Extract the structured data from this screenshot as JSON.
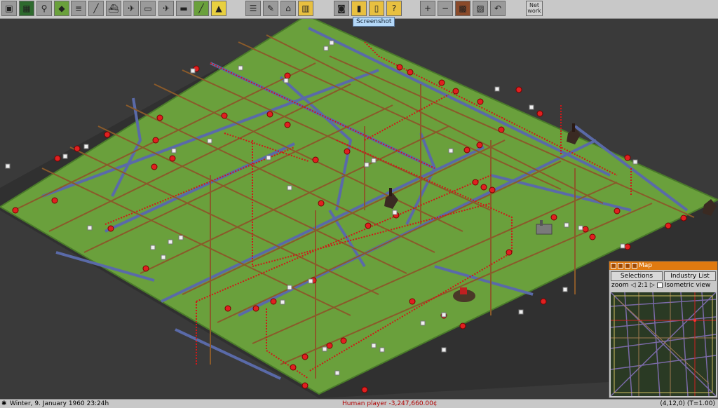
{
  "toolbar": {
    "icons": [
      "save-icon",
      "minimap-icon",
      "search-icon",
      "terrain-icon",
      "railway-icon",
      "road-icon",
      "ship-icon",
      "airport-icon",
      "tram-icon",
      "monorail-icon",
      "plane-icon",
      "maglev-icon",
      "narrowgauge-icon",
      "money-icon",
      "list-icon",
      "message-icon",
      "chart-icon",
      "camera-icon",
      "trash-icon",
      "finance-icon",
      "help-icon",
      "zoom-in-icon",
      "zoom-out-icon",
      "grid-icon",
      "hatch-icon",
      "undo-icon"
    ],
    "net_label": "Net\nwork"
  },
  "tooltip": {
    "screenshot": "Screenshot"
  },
  "minimap": {
    "title": "Map",
    "tabs": [
      "Selections",
      "Industry List"
    ],
    "zoom_label": "zoom",
    "zoom_value": "2:1",
    "isometric_label": "Isometric view"
  },
  "status": {
    "date": "Winter, 9. January 1960 23:24h",
    "player": "Human player",
    "money": "-3,247,660.00¢",
    "coords": "(4,12,0) (T=1.00)"
  },
  "colors": {
    "grass": "#6aa03c",
    "rail": "#8a5a2a",
    "road": "#5a6aa8",
    "signal": "#d01818",
    "station": "#d01818"
  }
}
